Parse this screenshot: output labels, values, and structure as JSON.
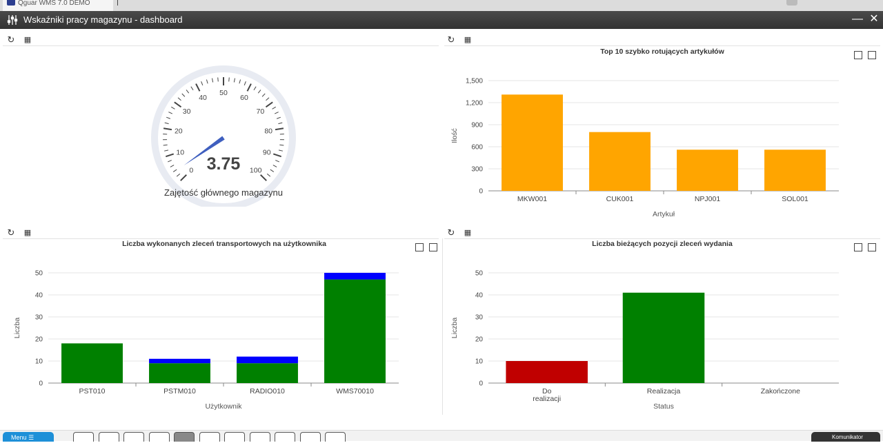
{
  "browser": {
    "tab_title": "Qguar WMS 7.0 DEMO"
  },
  "window": {
    "title": "Wskaźniki pracy magazynu - dashboard",
    "minimize": "—",
    "close": "✕"
  },
  "toolbar": {
    "refresh_icon": "refresh-icon",
    "grid_icon": "grid-icon"
  },
  "gauge": {
    "value": 3.75,
    "value_label": "3.75",
    "label": "Zajętość głównego magazynu",
    "min": 0,
    "max": 100,
    "ticks": [
      "0",
      "10",
      "20",
      "30",
      "40",
      "50",
      "60",
      "70",
      "80",
      "90",
      "100"
    ],
    "needle_color": "#3f5fbf"
  },
  "charts": [
    {
      "id": "top10",
      "type": "bar",
      "title": "Top 10 szybko rotujących artykułów",
      "xlabel": "Artykuł",
      "ylabel": "Ilość",
      "categories": [
        "MKW001",
        "CUK001",
        "NPJ001",
        "SOL001"
      ],
      "series": [
        {
          "values": [
            1310,
            800,
            560,
            560
          ],
          "color": "#ffa500"
        }
      ],
      "yticks": [
        "0",
        "300",
        "600",
        "900",
        "1,200",
        "1,500"
      ],
      "ylim": [
        0,
        1500
      ]
    },
    {
      "id": "transport",
      "type": "bar",
      "stacked": true,
      "title": "Liczba wykonanych zleceń transportowych na użytkownika",
      "xlabel": "Użytkownik",
      "ylabel": "Liczba",
      "categories": [
        "PST010",
        "PSTM010",
        "RADIO010",
        "WMS70010"
      ],
      "series": [
        {
          "values": [
            18,
            9,
            9,
            47
          ],
          "color": "#008000"
        },
        {
          "values": [
            0,
            2,
            3,
            3
          ],
          "color": "#0000ff"
        }
      ],
      "yticks": [
        "0",
        "10",
        "20",
        "30",
        "40",
        "50"
      ],
      "ylim": [
        0,
        50
      ]
    },
    {
      "id": "wydania",
      "type": "bar",
      "title": "Liczba bieżących pozycji zleceń wydania",
      "xlabel": "Status",
      "ylabel": "Liczba",
      "categories": [
        "Do realizacji",
        "Realizacja",
        "Zakończone"
      ],
      "series": [
        {
          "values": [
            10,
            41,
            0
          ],
          "colors": [
            "#c00000",
            "#008000",
            "#008000"
          ]
        }
      ],
      "yticks": [
        "0",
        "10",
        "20",
        "30",
        "40",
        "50"
      ],
      "ylim": [
        0,
        50
      ]
    }
  ],
  "chart_data": [
    {
      "type": "bar",
      "title": "Top 10 szybko rotujących artykułów",
      "xlabel": "Artykuł",
      "ylabel": "Ilość",
      "categories": [
        "MKW001",
        "CUK001",
        "NPJ001",
        "SOL001"
      ],
      "values": [
        1310,
        800,
        560,
        560
      ],
      "ylim": [
        0,
        1500
      ]
    },
    {
      "type": "bar",
      "title": "Liczba wykonanych zleceń transportowych na użytkownika",
      "xlabel": "Użytkownik",
      "ylabel": "Liczba",
      "categories": [
        "PST010",
        "PSTM010",
        "RADIO010",
        "WMS70010"
      ],
      "series": [
        {
          "values": [
            18,
            9,
            9,
            47
          ]
        },
        {
          "values": [
            0,
            2,
            3,
            3
          ]
        }
      ],
      "ylim": [
        0,
        50
      ]
    },
    {
      "type": "bar",
      "title": "Liczba bieżących pozycji zleceń wydania",
      "xlabel": "Status",
      "ylabel": "Liczba",
      "categories": [
        "Do realizacji",
        "Realizacja",
        "Zakończone"
      ],
      "values": [
        10,
        41,
        0
      ],
      "ylim": [
        0,
        50
      ]
    }
  ],
  "taskbar": {
    "menu_label": "Menu",
    "komunikator_label": "Komunikator",
    "buttons": [
      "window-icon",
      "box-icon",
      "screen-icon",
      "document-icon",
      "dashboard-icon",
      "list-icon",
      "chart-icon",
      "export-icon",
      "truck-icon",
      "delivery-icon",
      "layout-icon"
    ]
  }
}
